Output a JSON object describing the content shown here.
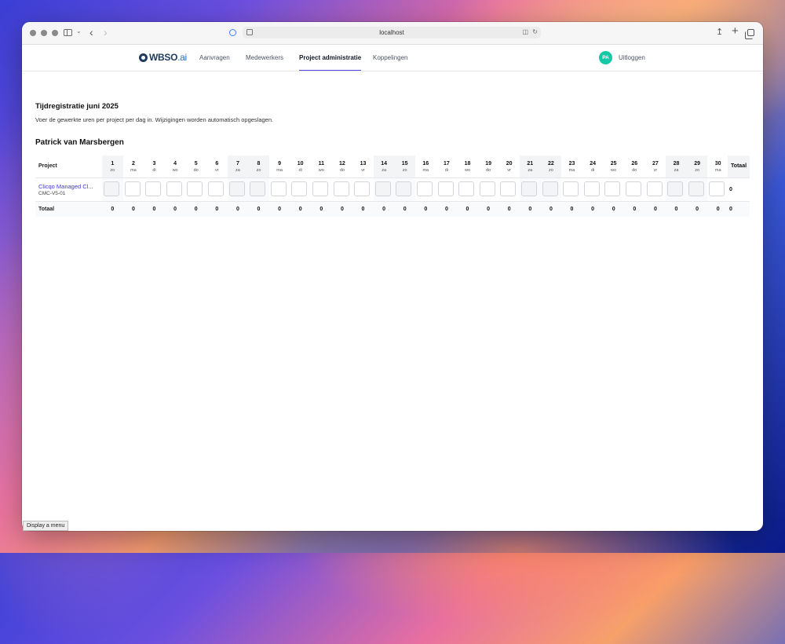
{
  "browser": {
    "url": "localhost"
  },
  "app": {
    "logo_text": "WBSO",
    "logo_suffix": ".ai",
    "nav": [
      {
        "label": "Aanvragen",
        "active": false
      },
      {
        "label": "Medewerkers",
        "active": false
      },
      {
        "label": "Project administratie",
        "active": true
      },
      {
        "label": "Koppelingen",
        "active": false
      }
    ],
    "user_initials": "PA",
    "logout_label": "Uitloggen"
  },
  "page": {
    "title": "Tijdregistratie juni 2025",
    "description": "Voer de gewerkte uren per project per dag in. Wijzigingen worden automatisch opgeslagen.",
    "person": "Patrick van Marsbergen"
  },
  "table": {
    "project_header": "Project",
    "total_header": "Totaal",
    "days": [
      {
        "num": "1",
        "name": "zo",
        "weekend": true
      },
      {
        "num": "2",
        "name": "ma",
        "weekend": false
      },
      {
        "num": "3",
        "name": "di",
        "weekend": false
      },
      {
        "num": "4",
        "name": "wo",
        "weekend": false
      },
      {
        "num": "5",
        "name": "do",
        "weekend": false
      },
      {
        "num": "6",
        "name": "vr",
        "weekend": false
      },
      {
        "num": "7",
        "name": "za",
        "weekend": true
      },
      {
        "num": "8",
        "name": "zo",
        "weekend": true
      },
      {
        "num": "9",
        "name": "ma",
        "weekend": false
      },
      {
        "num": "10",
        "name": "di",
        "weekend": false
      },
      {
        "num": "11",
        "name": "wo",
        "weekend": false
      },
      {
        "num": "12",
        "name": "do",
        "weekend": false
      },
      {
        "num": "13",
        "name": "vr",
        "weekend": false
      },
      {
        "num": "14",
        "name": "za",
        "weekend": true
      },
      {
        "num": "15",
        "name": "zo",
        "weekend": true
      },
      {
        "num": "16",
        "name": "ma",
        "weekend": false
      },
      {
        "num": "17",
        "name": "di",
        "weekend": false
      },
      {
        "num": "18",
        "name": "wo",
        "weekend": false
      },
      {
        "num": "19",
        "name": "do",
        "weekend": false
      },
      {
        "num": "20",
        "name": "vr",
        "weekend": false
      },
      {
        "num": "21",
        "name": "za",
        "weekend": true
      },
      {
        "num": "22",
        "name": "zo",
        "weekend": true
      },
      {
        "num": "23",
        "name": "ma",
        "weekend": false
      },
      {
        "num": "24",
        "name": "di",
        "weekend": false
      },
      {
        "num": "25",
        "name": "wo",
        "weekend": false
      },
      {
        "num": "26",
        "name": "do",
        "weekend": false
      },
      {
        "num": "27",
        "name": "vr",
        "weekend": false
      },
      {
        "num": "28",
        "name": "za",
        "weekend": true
      },
      {
        "num": "29",
        "name": "zo",
        "weekend": true
      },
      {
        "num": "30",
        "name": "ma",
        "weekend": false
      }
    ],
    "rows": [
      {
        "project_name": "Clicqo Managed Cl...",
        "project_code": "CMC-V5-01",
        "hours": [
          "",
          "",
          "",
          "",
          "",
          "",
          "",
          "",
          "",
          "",
          "",
          "",
          "",
          "",
          "",
          "",
          "",
          "",
          "",
          "",
          "",
          "",
          "",
          "",
          "",
          "",
          "",
          "",
          "",
          ""
        ],
        "total": "0"
      }
    ],
    "totals_label": "Totaal",
    "day_totals": [
      "0",
      "0",
      "0",
      "0",
      "0",
      "0",
      "0",
      "0",
      "0",
      "0",
      "0",
      "0",
      "0",
      "0",
      "0",
      "0",
      "0",
      "0",
      "0",
      "0",
      "0",
      "0",
      "0",
      "0",
      "0",
      "0",
      "0",
      "0",
      "0",
      "0"
    ],
    "grand_total": "0"
  },
  "tooltip": "Display a menu"
}
